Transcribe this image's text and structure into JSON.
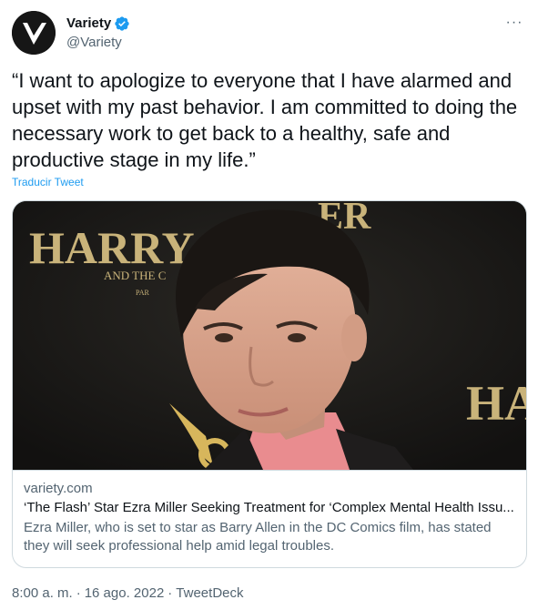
{
  "account": {
    "display_name": "Variety",
    "handle": "@Variety",
    "avatar_icon": "variety-v-logo",
    "verified_icon": "verified-badge-icon",
    "verified_color": "#1d9bf0"
  },
  "more_icon": "more-horizontal-icon",
  "more_glyph": "···",
  "tweet": {
    "text": "“I want to apologize to everyone that I have alarmed and upset with my past behavior. I am committed to doing the necessary work to get back to a healthy, safe and productive stage in my life.”",
    "translate_label": "Traducir Tweet"
  },
  "card": {
    "image_backdrop_text": {
      "harry": "HARRY",
      "potter_fragment": "ER",
      "and_the": "AND THE C",
      "part": "PAR",
      "right": "HA"
    },
    "domain": "variety.com",
    "title": "‘The Flash’ Star Ezra Miller Seeking Treatment for ‘Complex Mental Health Issu...",
    "description": "Ezra Miller, who is set to star as Barry Allen in the DC Comics film, has stated they will seek professional help amid legal troubles."
  },
  "meta": {
    "time": "8:00 a. m.",
    "date": "16 ago. 2022",
    "source": "TweetDeck",
    "separator": "·"
  },
  "colors": {
    "accent": "#1d9bf0",
    "text": "#0f1419",
    "secondary": "#536471",
    "border": "#cfd9de"
  }
}
